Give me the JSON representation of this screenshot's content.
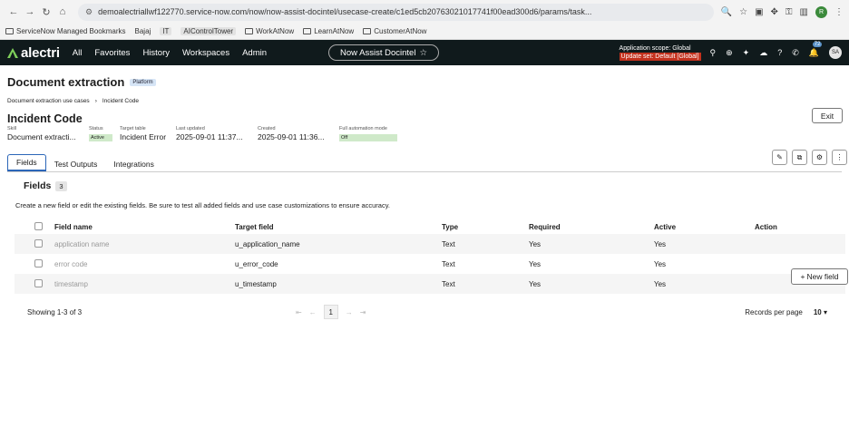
{
  "browser": {
    "url": "demoalectriallwf122770.service-now.com/now/now-assist-docintel/usecase-create/c1ed5cb20763021017741f00ead300d6/params/task...",
    "profile_initial": "R",
    "bookmarks": [
      "ServiceNow Managed Bookmarks",
      "Bajaj",
      "IT",
      "AIControlTower",
      "WorkAtNow",
      "LearnAtNow",
      "CustomerAtNow"
    ]
  },
  "header": {
    "logo": "alectri",
    "nav": [
      "All",
      "Favorites",
      "History",
      "Workspaces",
      "Admin"
    ],
    "center_pill": "Now Assist Docintel",
    "scope_line1": "Application scope: Global",
    "scope_line2": "Update set: Default [Global]",
    "notif_count": "72",
    "avatar": "SA"
  },
  "page": {
    "title": "Document extraction",
    "badge": "Platform",
    "breadcrumb": [
      "Document extraction use cases",
      "Incident Code"
    ],
    "exit": "Exit",
    "record_title": "Incident Code",
    "meta": {
      "skill_label": "Skill",
      "skill_value": "Document extracti...",
      "status_label": "Status",
      "status_value": "Active",
      "target_label": "Target table",
      "target_value": "Incident Error",
      "updated_label": "Last updated",
      "updated_value": "2025-09-01 11:37...",
      "created_label": "Created",
      "created_value": "2025-09-01 11:36...",
      "auto_label": "Full automation mode",
      "auto_value": "Off"
    },
    "tabs": [
      "Fields",
      "Test Outputs",
      "Integrations"
    ],
    "fields_title": "Fields",
    "fields_count": "3",
    "new_field": "New field",
    "helper": "Create a new field or edit the existing fields. Be sure to test all added fields and use case customizations to ensure accuracy.",
    "columns": [
      "Field name",
      "Target field",
      "Type",
      "Required",
      "Active",
      "Action"
    ],
    "rows": [
      {
        "name": "application name",
        "target": "u_application_name",
        "type": "Text",
        "required": "Yes",
        "active": "Yes"
      },
      {
        "name": "error code",
        "target": "u_error_code",
        "type": "Text",
        "required": "Yes",
        "active": "Yes"
      },
      {
        "name": "timestamp",
        "target": "u_timestamp",
        "type": "Text",
        "required": "Yes",
        "active": "Yes"
      }
    ],
    "showing": "Showing 1-3 of 3",
    "current_page": "1",
    "rpp_label": "Records per page",
    "rpp_value": "10"
  },
  "colors": {
    "header_bg": "#101a1c",
    "accent": "#2c66b8",
    "logo_green": "#7fd05b"
  }
}
